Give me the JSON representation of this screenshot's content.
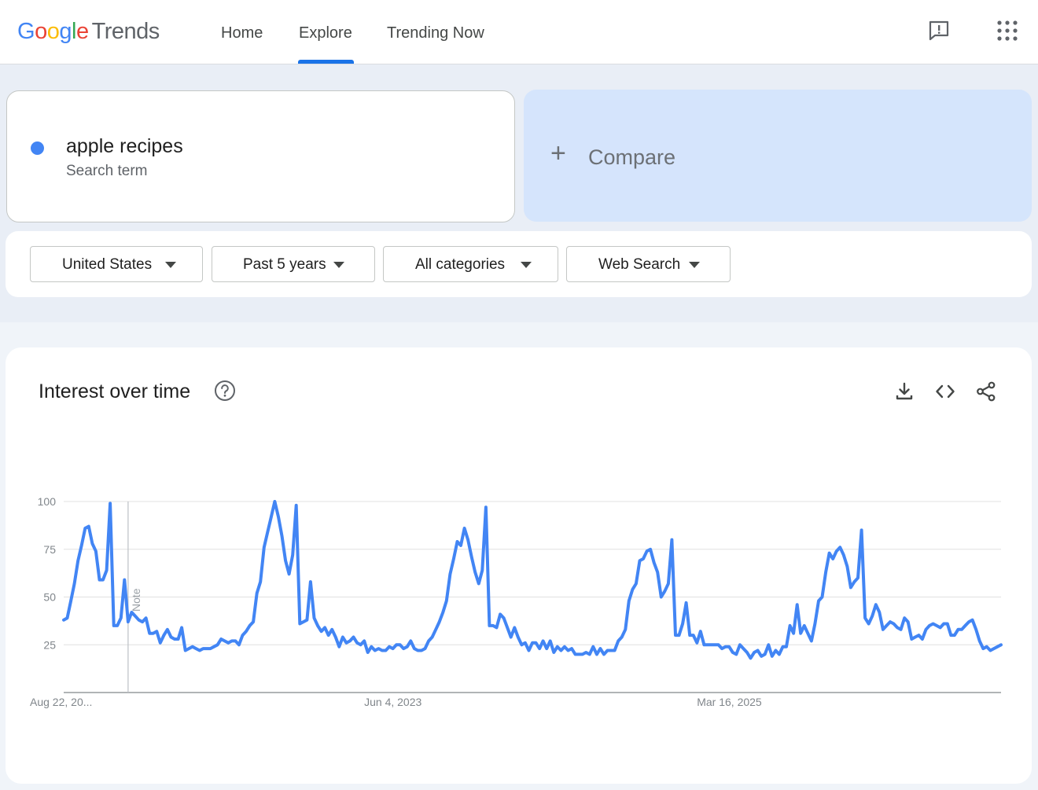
{
  "header": {
    "logo": {
      "g": "G",
      "o1": "o",
      "o2": "o",
      "g2": "g",
      "l": "l",
      "e": "e",
      "product": "Trends"
    },
    "nav": [
      {
        "label": "Home"
      },
      {
        "label": "Explore"
      },
      {
        "label": "Trending Now"
      }
    ],
    "active_nav": "Explore",
    "icons": [
      "feedback-icon",
      "apps-grid-icon"
    ]
  },
  "search": {
    "term": "apple recipes",
    "term_type": "Search term",
    "term_color": "#4285f4",
    "compare_label": "Compare"
  },
  "filters": {
    "region": "United States",
    "time_range": "Past 5 years",
    "category": "All categories",
    "property": "Web Search"
  },
  "chart_card": {
    "title": "Interest over time",
    "icons": [
      "help-icon",
      "download-icon",
      "embed-icon",
      "share-icon"
    ]
  },
  "chart_data": {
    "type": "line",
    "title": "",
    "xlabel": "",
    "ylabel": "",
    "ylim": [
      0,
      100
    ],
    "yticks": [
      25,
      50,
      75,
      100
    ],
    "xtick_labels": [
      "Aug 22, 20...",
      "Jun 4, 2023",
      "Mar 16, 2025"
    ],
    "xtick_index": [
      0,
      93,
      186
    ],
    "note_index": 18,
    "note_label": "Note",
    "grid": true,
    "series": [
      {
        "color": "#4285f4",
        "values": [
          38,
          39,
          48,
          57,
          69,
          77,
          86,
          87,
          78,
          74,
          59,
          59,
          64,
          99,
          35,
          35,
          39,
          59,
          37,
          42,
          40,
          38,
          37,
          39,
          31,
          31,
          32,
          26,
          30,
          33,
          29,
          28,
          28,
          34,
          22,
          23,
          24,
          23,
          22,
          23,
          23,
          23,
          24,
          25,
          28,
          27,
          26,
          27,
          27,
          25,
          30,
          32,
          35,
          37,
          52,
          58,
          76,
          84,
          92,
          100,
          92,
          82,
          69,
          62,
          72,
          98,
          36,
          37,
          38,
          58,
          39,
          35,
          32,
          34,
          30,
          33,
          29,
          24,
          29,
          26,
          27,
          29,
          26,
          25,
          27,
          21,
          24,
          22,
          23,
          22,
          22,
          24,
          23,
          25,
          25,
          23,
          24,
          27,
          23,
          22,
          22,
          23,
          27,
          29,
          33,
          37,
          42,
          48,
          62,
          70,
          79,
          77,
          86,
          80,
          71,
          63,
          57,
          64,
          97,
          35,
          35,
          34,
          41,
          39,
          34,
          29,
          34,
          29,
          25,
          26,
          22,
          26,
          26,
          23,
          27,
          23,
          27,
          21,
          24,
          22,
          24,
          22,
          23,
          20,
          20,
          20,
          21,
          20,
          24,
          20,
          23,
          20,
          22,
          22,
          22,
          27,
          29,
          33,
          48,
          54,
          57,
          69,
          70,
          74,
          75,
          68,
          63,
          50,
          53,
          57,
          80,
          30,
          30,
          36,
          47,
          30,
          30,
          26,
          32,
          25,
          25,
          25,
          25,
          25,
          23,
          24,
          24,
          21,
          20,
          25,
          23,
          21,
          18,
          21,
          22,
          19,
          20,
          25,
          19,
          22,
          20,
          24,
          24,
          35,
          31,
          46,
          31,
          35,
          31,
          27,
          36,
          48,
          50,
          63,
          73,
          70,
          74,
          76,
          72,
          66,
          55,
          58,
          60,
          85,
          39,
          36,
          40,
          46,
          42,
          33,
          35,
          37,
          36,
          34,
          33,
          39,
          37,
          28,
          29,
          30,
          28,
          33,
          35,
          36,
          35,
          34,
          36,
          36,
          30,
          30,
          33,
          33,
          35,
          37,
          38,
          33,
          27,
          23,
          24,
          22,
          23,
          24,
          25
        ]
      }
    ]
  }
}
